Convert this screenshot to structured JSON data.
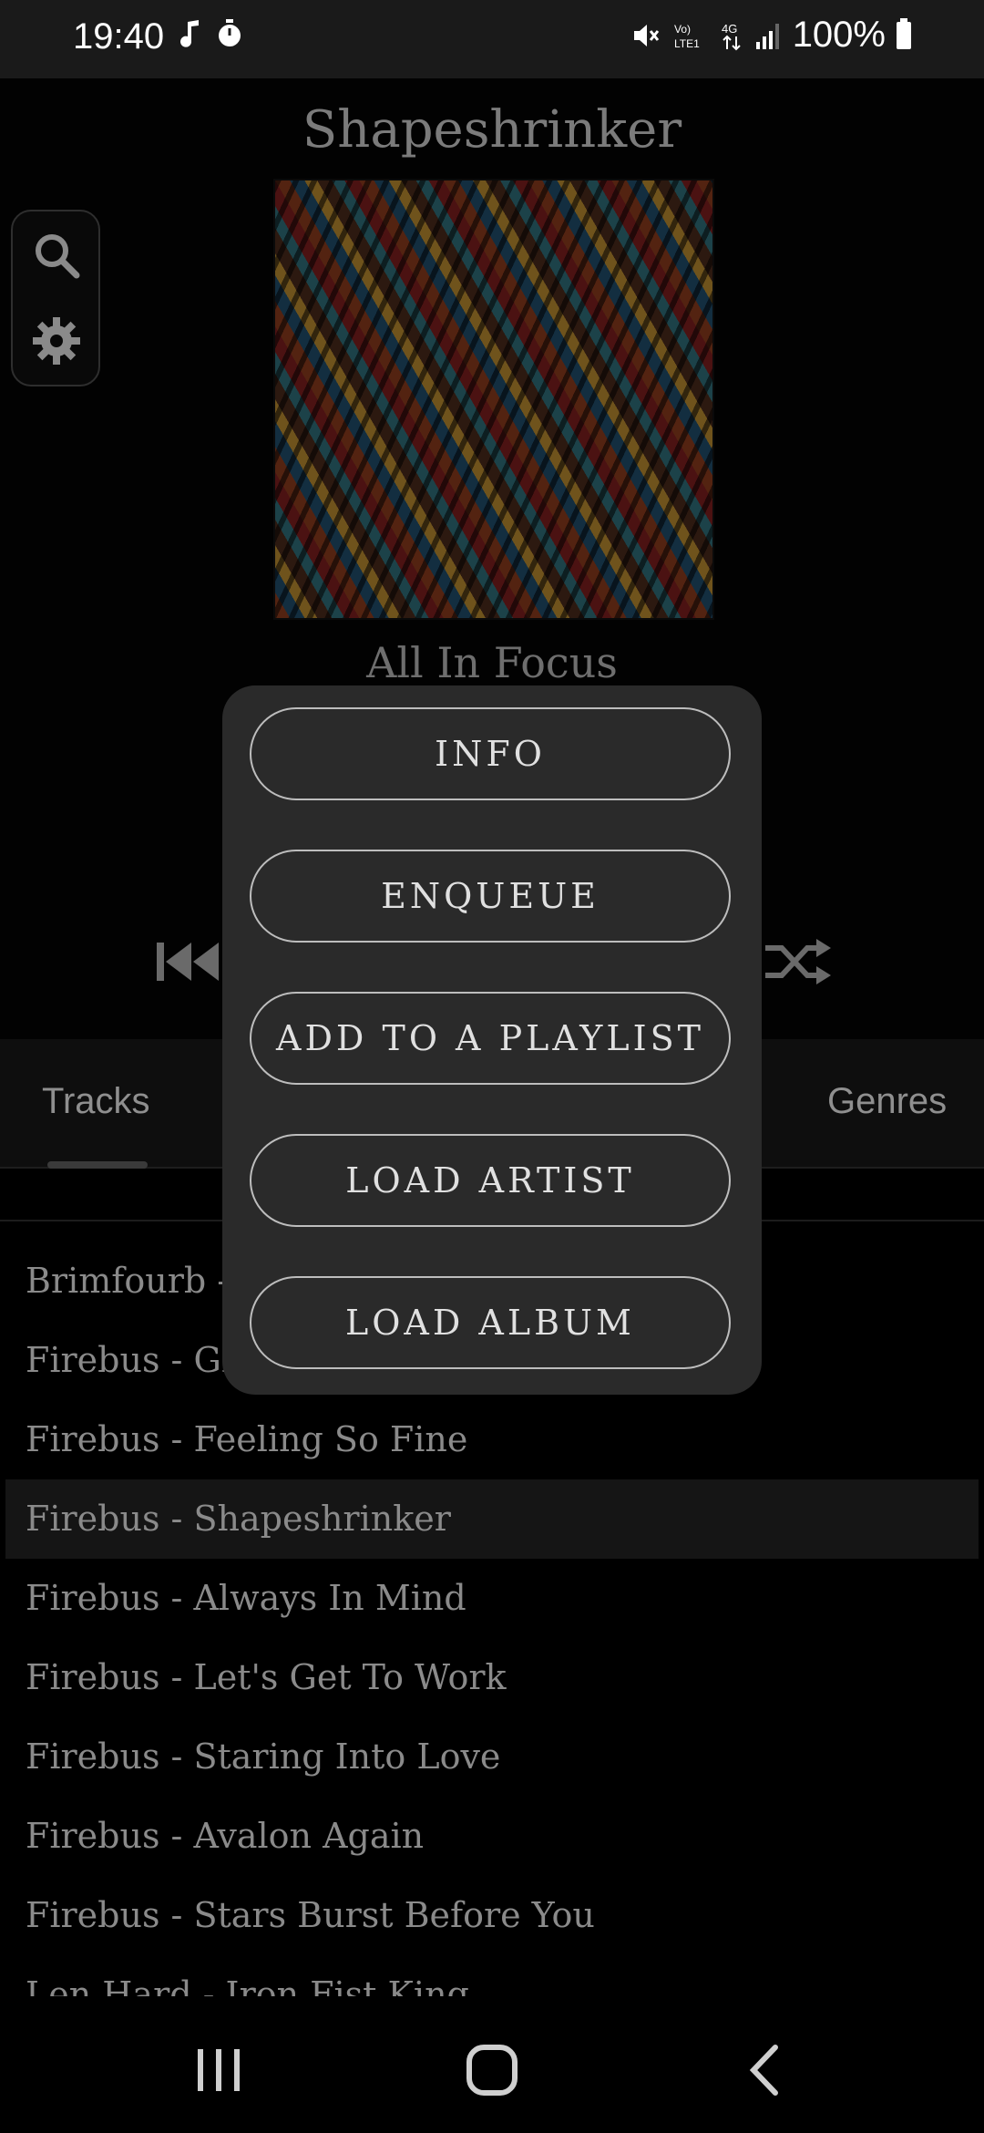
{
  "status": {
    "time": "19:40",
    "battery": "100%"
  },
  "player": {
    "title": "Shapeshrinker",
    "album": "All In Focus"
  },
  "tabs": {
    "tracks": "Tracks",
    "genres": "Genres"
  },
  "tracks": [
    "Brimfourb - ",
    "Firebus - Gre",
    "Firebus - Feeling So Fine",
    "Firebus - Shapeshrinker",
    "Firebus - Always In Mind",
    "Firebus - Let's Get To Work",
    "Firebus - Staring Into Love",
    "Firebus - Avalon Again",
    "Firebus - Stars Burst Before You",
    "Len Hard - Iron Fist King"
  ],
  "dialog": {
    "info": "INFO",
    "enqueue": "ENQUEUE",
    "add_playlist": "ADD TO A PLAYLIST",
    "load_artist": "LOAD ARTIST",
    "load_album": "LOAD ALBUM"
  }
}
